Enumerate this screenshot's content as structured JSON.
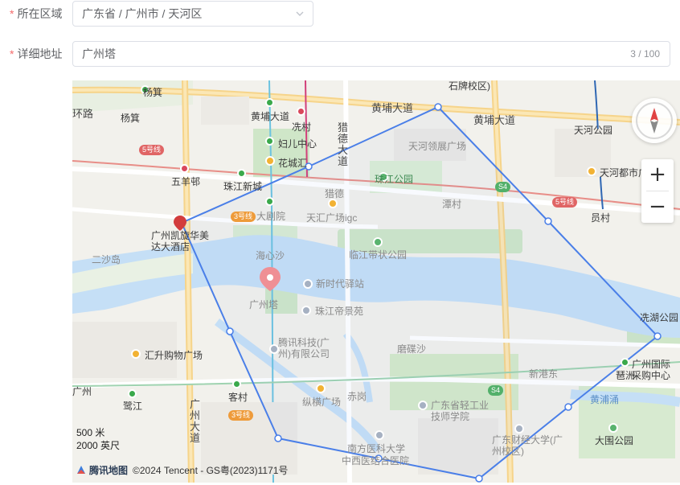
{
  "form": {
    "region": {
      "required_mark": "*",
      "label": "所在区域",
      "value": "广东省 / 广州市 / 天河区"
    },
    "address": {
      "required_mark": "*",
      "label": "详细地址",
      "value": "广州塔",
      "counter": "3 / 100"
    }
  },
  "map": {
    "roads": [
      "黄埔大道",
      "黄埔大道",
      "猎德大道",
      "广州大道",
      "环路"
    ],
    "labels": {
      "yangji_top": "杨箕",
      "yangji": "杨箕",
      "huanlu": "环路",
      "shipai": "石牌校区)",
      "huangpu_dadao_w": "黄埔大道",
      "xiancun": "冼村",
      "fuer": "妇儿中心",
      "huacheng": "花城汇",
      "liede_dadao": "猎德大道",
      "tianhe_lingzhan": "天河领展广场",
      "zhujiang_park": "珠江公园",
      "huangpu_dadao_e": "黄埔大道",
      "tianhe_park": "天河公园",
      "tianhe_duhui": "天河都市广",
      "wuyangcun": "五羊邨",
      "zhujiang_xincheng": "珠江新城",
      "liede": "猎德",
      "tanchun": "潭村",
      "yuancun": "员村",
      "dajuyuan": "大剧院",
      "tianhui": "天汇广场igc",
      "kaixuan": "广州凯旋华美达大酒店",
      "linjiang": "临江带状公园",
      "ershadao": "二沙岛",
      "haixinsha": "海心沙",
      "xinshidai": "新时代驿站",
      "canton_tower": "广州塔",
      "zhujiang_dijing": "珠江帝景苑",
      "tengxun": "腾讯科技(广州)有限公司",
      "pazhou": "磨碟沙",
      "huisheng": "汇升购物广场",
      "xingangdong": "新港东",
      "pazhou_st": "琶洲",
      "canton_fair": "广州国际采购中心",
      "jiagong": "黄浦涌",
      "zhongda": "广州大道",
      "kecun": "客村",
      "heyi": "鹭江",
      "zongheng": "纵横广场",
      "chigang": "赤岗",
      "qinggong": "广东省轻工业技师学院",
      "caijing": "广东财经大学(广州校区)",
      "datang_park": "大围公园",
      "nanfang_yike": "南方医科大学",
      "zhongxi": "中西医结合医院",
      "guangzhou_left": "广州",
      "xiangjiang": "冼湖公园",
      "line5_a": "5号线",
      "line5_b": "5号线",
      "line3_a": "3号线",
      "line3_b": "3号线",
      "s4": "S4",
      "s4b": "S4"
    },
    "scale": {
      "metric": "500 米",
      "imperial": "2000 英尺"
    },
    "attribution": {
      "logo": "腾讯地图",
      "text": "©2024 Tencent - GS粤(2023)1171号"
    },
    "zoom_in": "+",
    "zoom_out": "−",
    "polygon_color": "#4a7fe8"
  }
}
